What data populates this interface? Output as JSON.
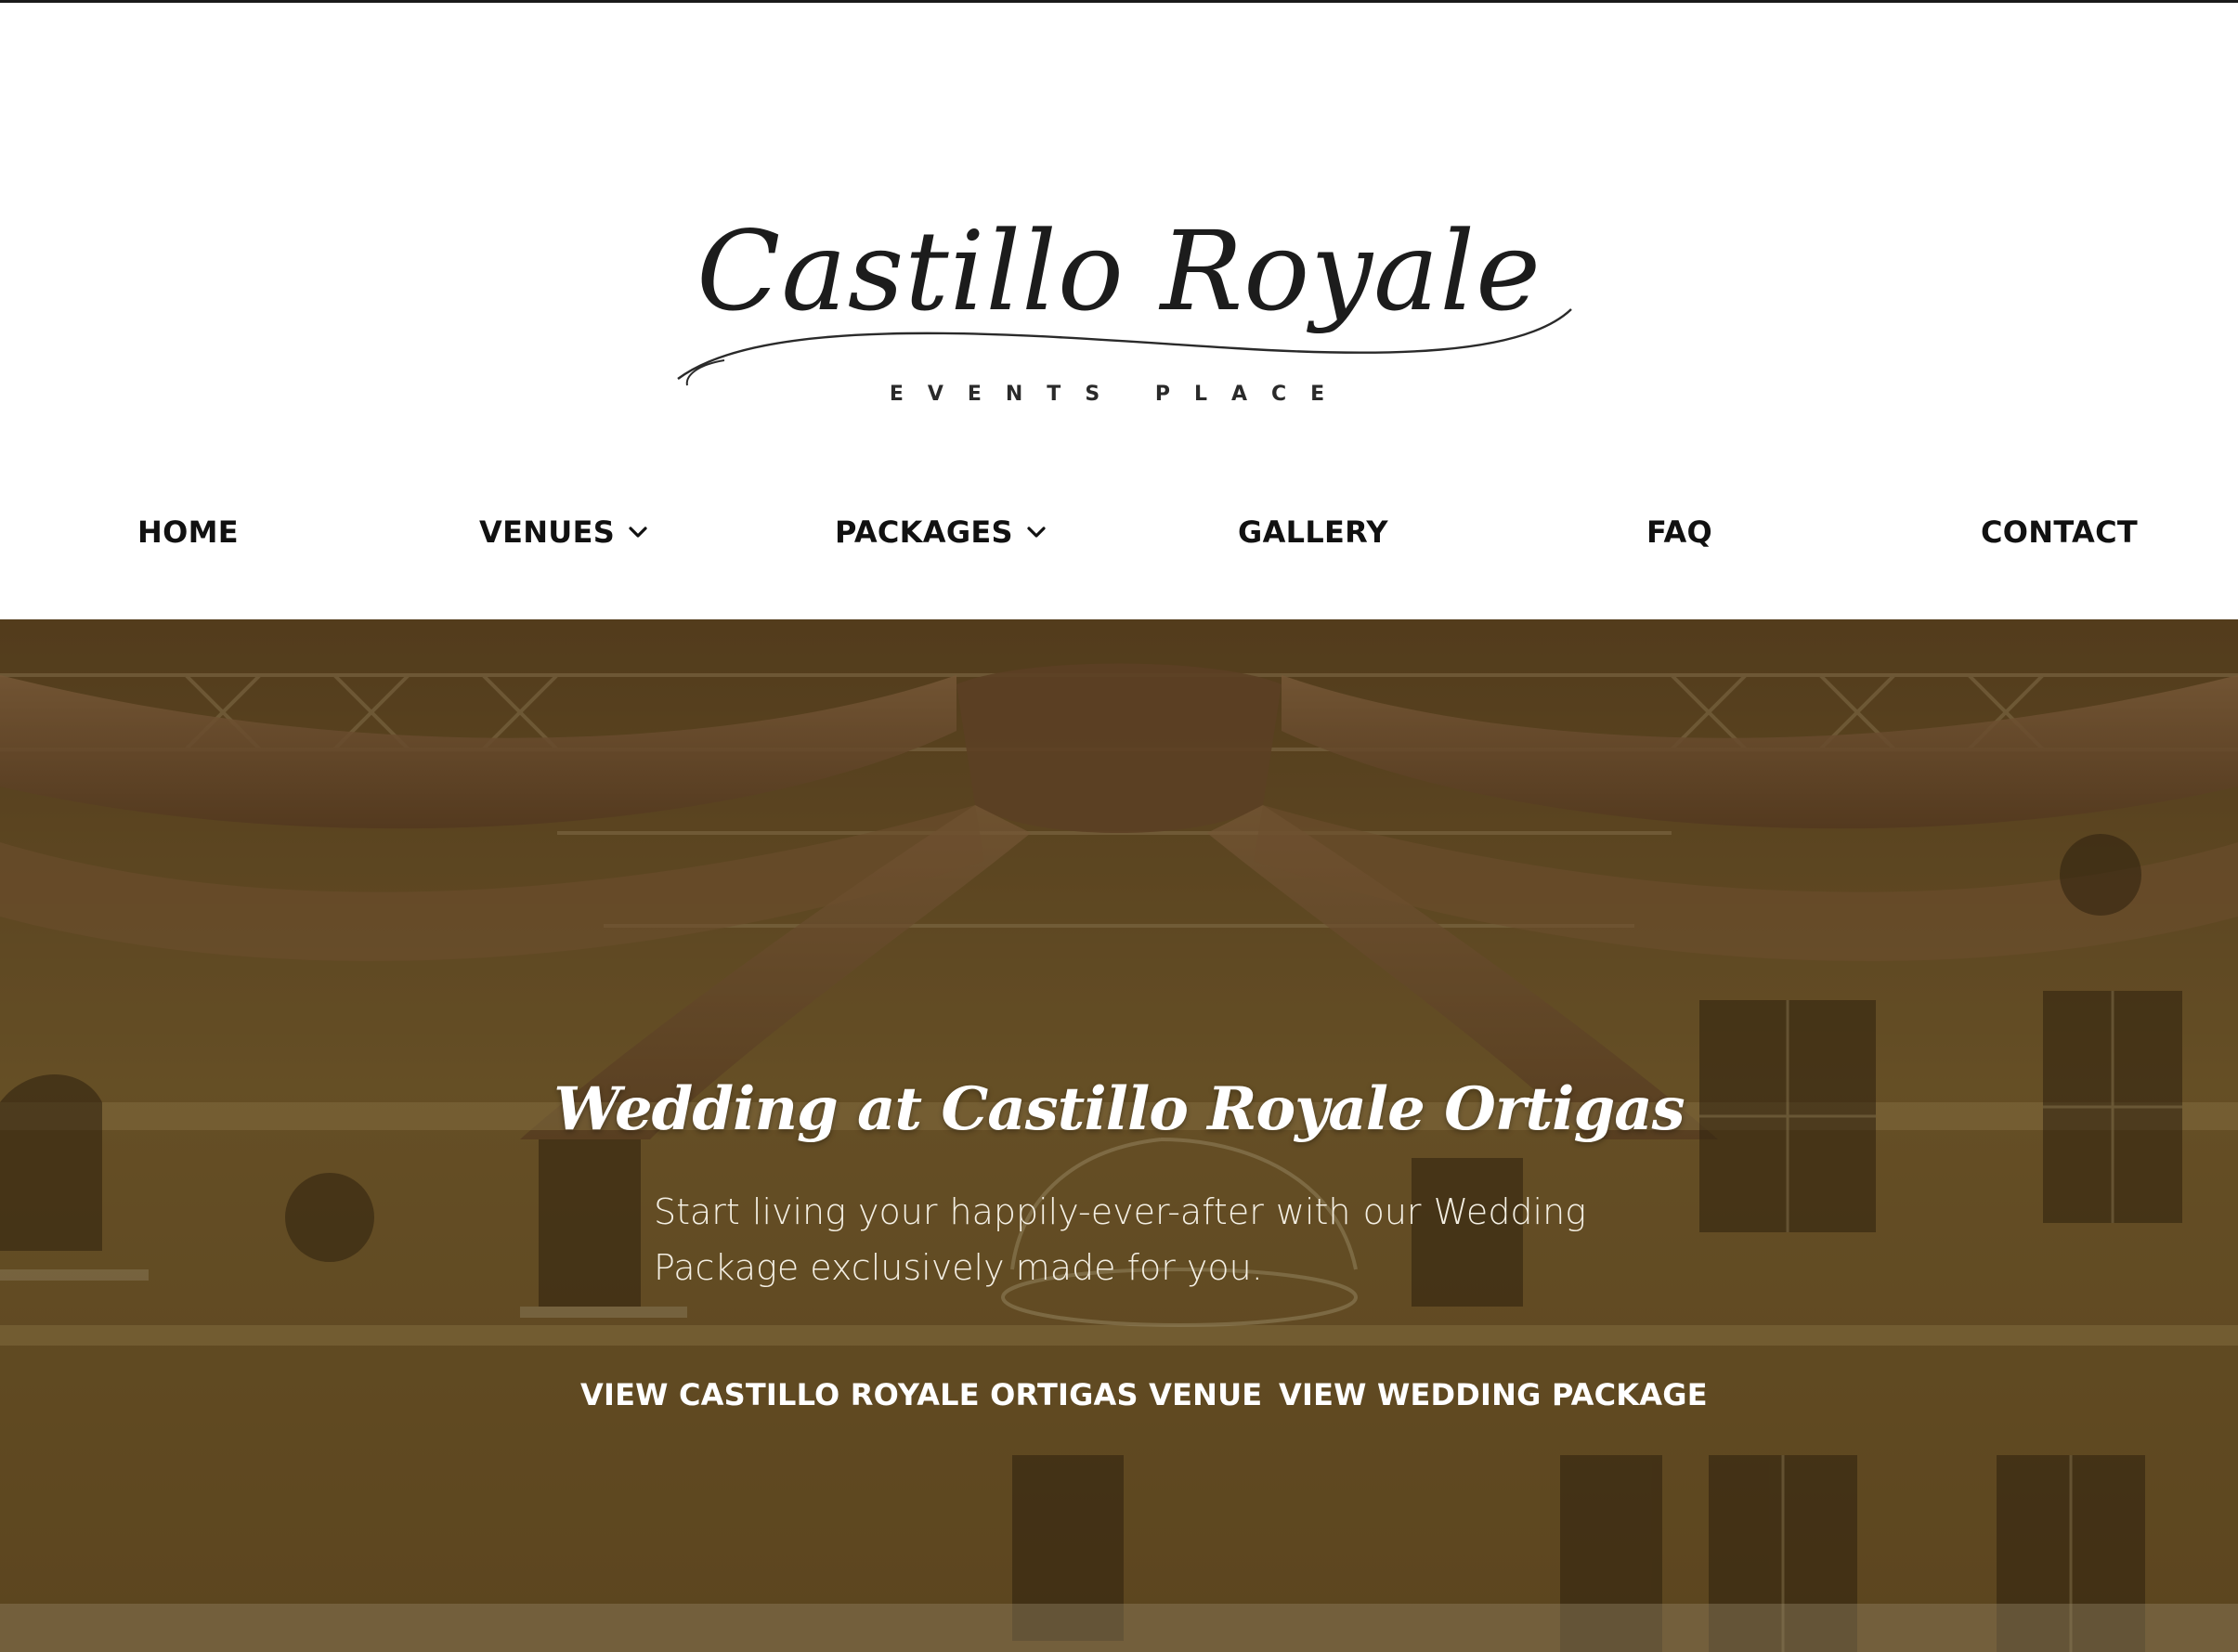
{
  "logo": {
    "name": "Castillo Royale",
    "tagline": "EVENTS PLACE"
  },
  "nav": {
    "items": [
      {
        "label": "HOME",
        "has_dropdown": false
      },
      {
        "label": "VENUES",
        "has_dropdown": true
      },
      {
        "label": "PACKAGES",
        "has_dropdown": true
      },
      {
        "label": "GALLERY",
        "has_dropdown": false
      },
      {
        "label": "FAQ",
        "has_dropdown": false
      },
      {
        "label": "CONTACT",
        "has_dropdown": false
      }
    ],
    "dropdown_icon": "chevron-down-icon"
  },
  "hero": {
    "title": "Wedding at Castillo Royale Ortigas",
    "subtitle": "Start living your happily-ever-after with our Wedding Package exclusively made for you.",
    "buttons": [
      {
        "label": "VIEW CASTILLO ROYALE ORTIGAS VENUE"
      },
      {
        "label": "VIEW WEDDING PACKAGE"
      }
    ]
  },
  "colors": {
    "nav_text": "#111111",
    "hero_text": "#ffffff",
    "hero_tint": "#4a3818"
  }
}
